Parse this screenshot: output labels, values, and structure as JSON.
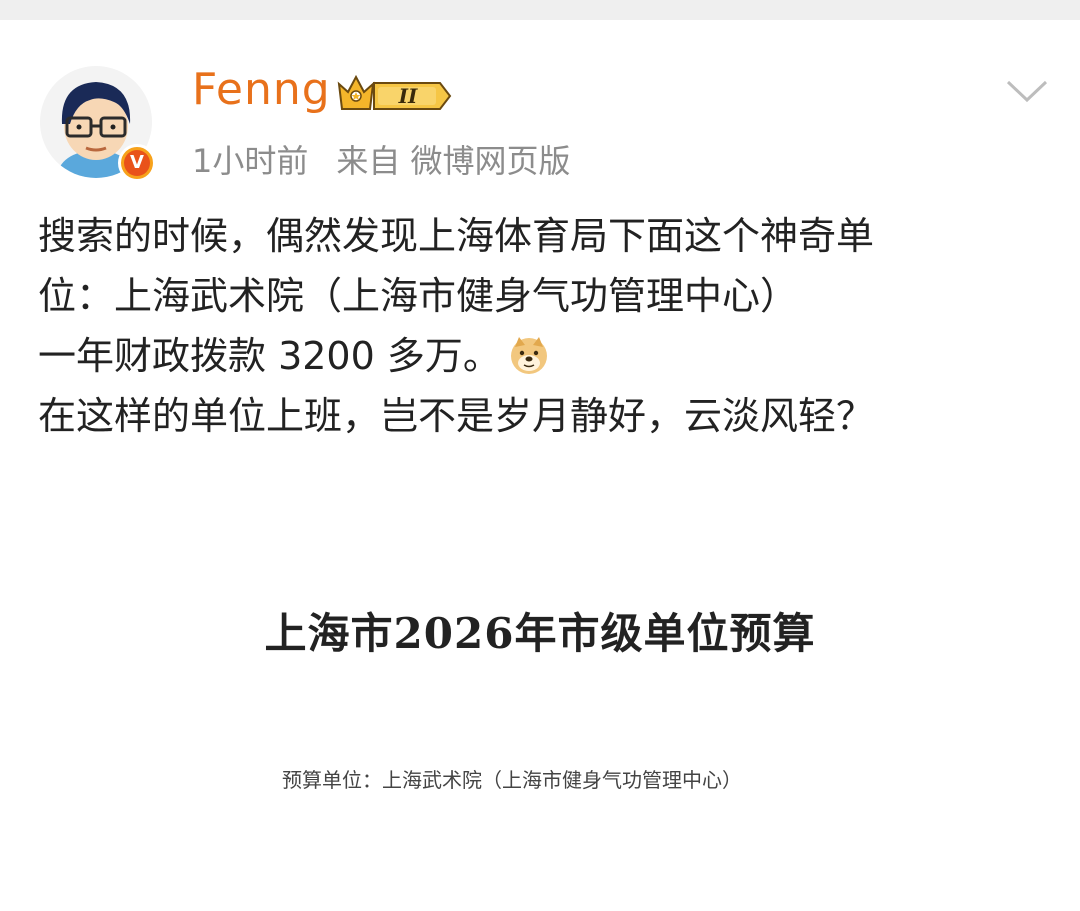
{
  "post": {
    "author": "Fenng",
    "time": "1小时前",
    "source": "来自 微博网页版",
    "lines": [
      "搜索的时候，偶然发现上海体育局下面这个神奇单",
      "位：上海武术院（上海市健身气功管理中心）",
      "一年财政拨款 3200 多万。",
      "在这样的单位上班，岂不是岁月静好，云淡风轻？"
    ],
    "emoji": "doge-emoji"
  },
  "badges": {
    "verified": "V",
    "level": "II"
  },
  "icons": {
    "more": "chevron-down-icon",
    "crown": "crown-icon"
  },
  "attachment": {
    "title": "上海市2026年市级单位预算",
    "subtitle": "预算单位：上海武术院（上海市健身气功管理中心）"
  },
  "colors": {
    "username": "#e8711b",
    "meta": "#8c8c8c",
    "text": "#222222",
    "verified": "#e9521a",
    "crown": "#f4b52a"
  }
}
